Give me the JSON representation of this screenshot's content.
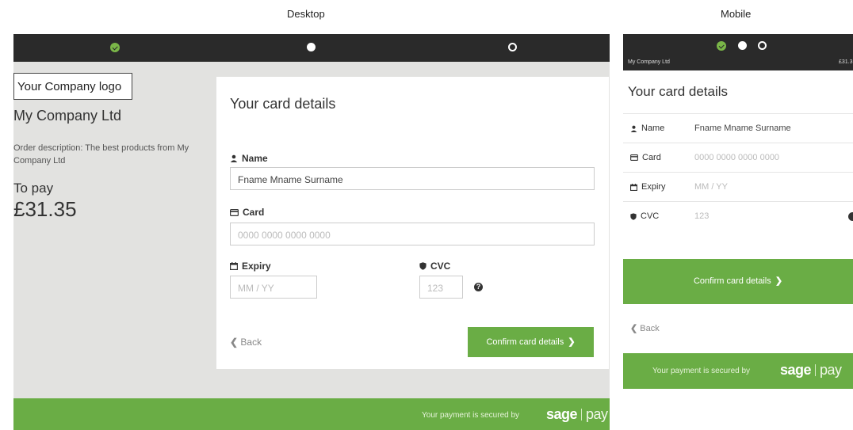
{
  "headings": {
    "desktop": "Desktop",
    "mobile": "Mobile"
  },
  "company": {
    "logo_placeholder": "Your Company logo",
    "name": "My Company Ltd",
    "order_description": "Order description: The best products from My Company Ltd"
  },
  "payment": {
    "to_pay_label": "To pay",
    "amount": "£31.35",
    "amount_short": "£31.3"
  },
  "steps": [
    "complete",
    "current",
    "pending"
  ],
  "form": {
    "title": "Your card details",
    "name": {
      "label": "Name",
      "value": "Fname Mname Surname"
    },
    "card": {
      "label": "Card",
      "placeholder": "0000 0000 0000 0000"
    },
    "expiry": {
      "label": "Expiry",
      "placeholder": "MM  /  YY"
    },
    "cvc": {
      "label": "CVC",
      "label_mobile": "CVC",
      "placeholder": "123"
    },
    "back_label": "Back",
    "confirm_label": "Confirm card details"
  },
  "footer": {
    "secured_text": "Your payment is secured by",
    "brand_left": "sage",
    "brand_right": "pay"
  },
  "colors": {
    "accent_green": "#6aad45",
    "step_bar": "#2a2a2a",
    "panel_bg": "#e2e2e0"
  }
}
